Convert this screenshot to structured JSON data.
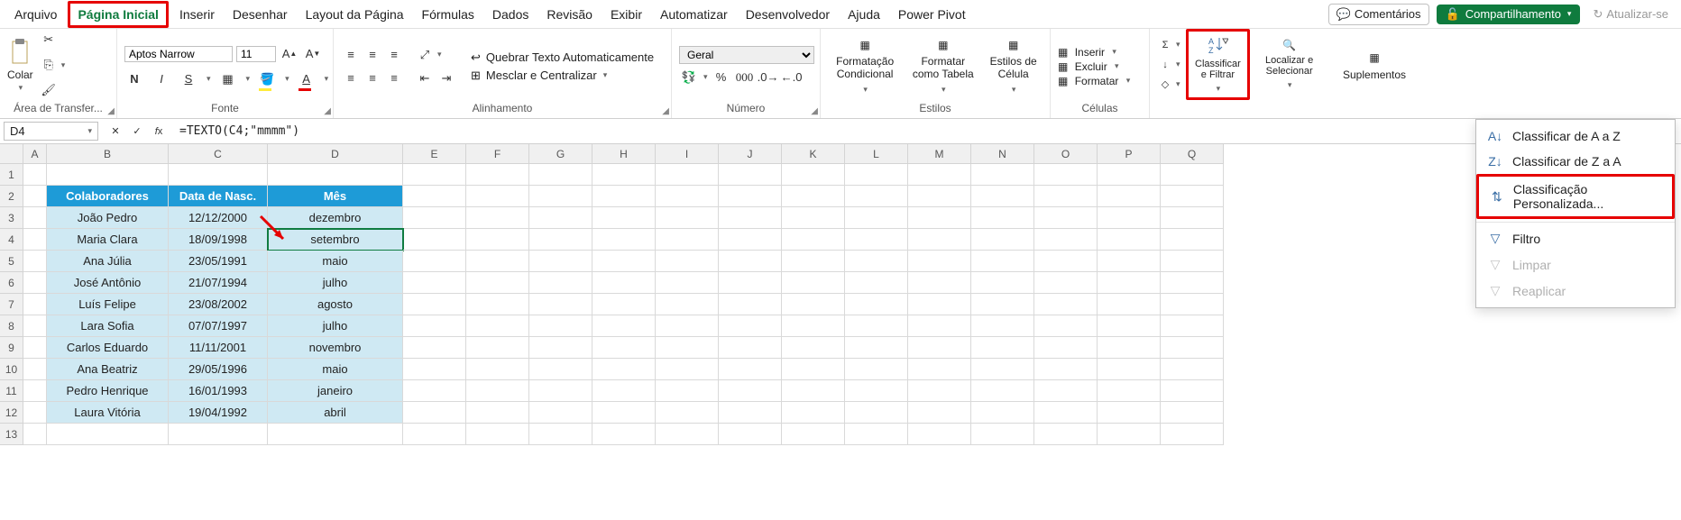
{
  "menu": {
    "items": [
      "Arquivo",
      "Página Inicial",
      "Inserir",
      "Desenhar",
      "Layout da Página",
      "Fórmulas",
      "Dados",
      "Revisão",
      "Exibir",
      "Automatizar",
      "Desenvolvedor",
      "Ajuda",
      "Power Pivot"
    ],
    "active": "Página Inicial"
  },
  "top_actions": {
    "comments": "Comentários",
    "share": "Compartilhamento",
    "update": "Atualizar-se"
  },
  "ribbon": {
    "clipboard": {
      "paste": "Colar",
      "label": "Área de Transfer..."
    },
    "font": {
      "name": "Aptos Narrow",
      "size": "11",
      "label": "Fonte"
    },
    "alignment": {
      "wrap": "Quebrar Texto Automaticamente",
      "merge": "Mesclar e Centralizar",
      "label": "Alinhamento"
    },
    "number": {
      "format": "Geral",
      "label": "Número"
    },
    "styles": {
      "cond": "Formatação Condicional",
      "table": "Formatar como Tabela",
      "cell": "Estilos de Célula",
      "label": "Estilos"
    },
    "cells": {
      "insert": "Inserir",
      "delete": "Excluir",
      "format": "Formatar",
      "label": "Células"
    },
    "editing": {
      "sort": "Classificar e Filtrar",
      "find": "Localizar e Selecionar"
    },
    "addins": {
      "label": "Suplementos"
    }
  },
  "sort_menu": {
    "az": "Classificar de A a Z",
    "za": "Classificar de Z a A",
    "custom": "Classificação Personalizada...",
    "filter": "Filtro",
    "clear": "Limpar",
    "reapply": "Reaplicar"
  },
  "formula_bar": {
    "ref": "D4",
    "formula": "=TEXTO(C4;\"mmmm\")"
  },
  "columns": [
    "A",
    "B",
    "C",
    "D",
    "E",
    "F",
    "G",
    "H",
    "I",
    "J",
    "K",
    "L",
    "M",
    "N",
    "O",
    "P",
    "Q"
  ],
  "col_widths": {
    "A": 26,
    "B": 135,
    "C": 110,
    "D": 150,
    "default": 70
  },
  "rows_shown": [
    1,
    2,
    3,
    4,
    5,
    6,
    7,
    8,
    9,
    10,
    11,
    12,
    13
  ],
  "table": {
    "headers": [
      "Colaboradores",
      "Data de Nasc.",
      "Mês"
    ],
    "rows": [
      [
        "João Pedro",
        "12/12/2000",
        "dezembro"
      ],
      [
        "Maria Clara",
        "18/09/1998",
        "setembro"
      ],
      [
        "Ana Júlia",
        "23/05/1991",
        "maio"
      ],
      [
        "José Antônio",
        "21/07/1994",
        "julho"
      ],
      [
        "Luís Felipe",
        "23/08/2002",
        "agosto"
      ],
      [
        "Lara Sofia",
        "07/07/1997",
        "julho"
      ],
      [
        "Carlos Eduardo",
        "11/11/2001",
        "novembro"
      ],
      [
        "Ana Beatriz",
        "29/05/1996",
        "maio"
      ],
      [
        "Pedro Henrique",
        "16/01/1993",
        "janeiro"
      ],
      [
        "Laura Vitória",
        "19/04/1992",
        "abril"
      ]
    ]
  },
  "selected": "D4"
}
